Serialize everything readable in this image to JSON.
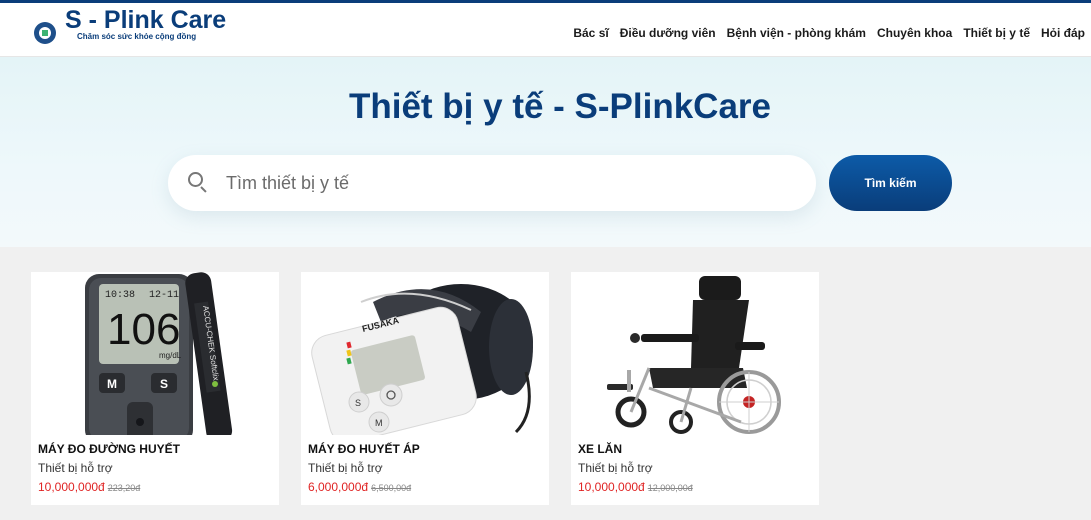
{
  "header": {
    "logo_title": "S - Plink Care",
    "logo_tagline": "Chăm sóc sức khỏe cộng đồng",
    "nav": [
      "Bác sĩ",
      "Điều dưỡng viên",
      "Bệnh viện - phòng khám",
      "Chuyên khoa",
      "Thiết bị y tế",
      "Hỏi đáp"
    ]
  },
  "hero": {
    "title": "Thiết bị y tế - S-PlinkCare",
    "search_placeholder": "Tìm thiết bị y tế",
    "search_value": "",
    "search_button": "Tìm kiếm"
  },
  "products": [
    {
      "name": "MÁY ĐO ĐƯỜNG HUYẾT",
      "category": "Thiết bị hỗ trợ",
      "price": "10,000,000đ",
      "old_price": "223,20đ",
      "image": "glucose-meter",
      "meter_reading": "106",
      "meter_time": "10:38",
      "meter_date": "12-11",
      "meter_unit": "mg/dL",
      "meter_buttons": [
        "M",
        "S"
      ],
      "strip_brand": "ACCU-CHEK Softclix"
    },
    {
      "name": "MÁY ĐO HUYẾT ÁP",
      "category": "Thiết bị hỗ trợ",
      "price": "6,000,000đ",
      "old_price": "6,500,00đ",
      "image": "blood-pressure-monitor",
      "device_brand": "FUSAKA",
      "device_buttons": [
        "S",
        "M"
      ]
    },
    {
      "name": "XE LĂN",
      "category": "Thiết bị hỗ trợ",
      "price": "10,000,000đ",
      "old_price": "12,000,00đ",
      "image": "wheelchair"
    }
  ],
  "colors": {
    "brand": "#0a3d7a",
    "price": "#e02424",
    "hero_bg": "#e4f4f7"
  }
}
